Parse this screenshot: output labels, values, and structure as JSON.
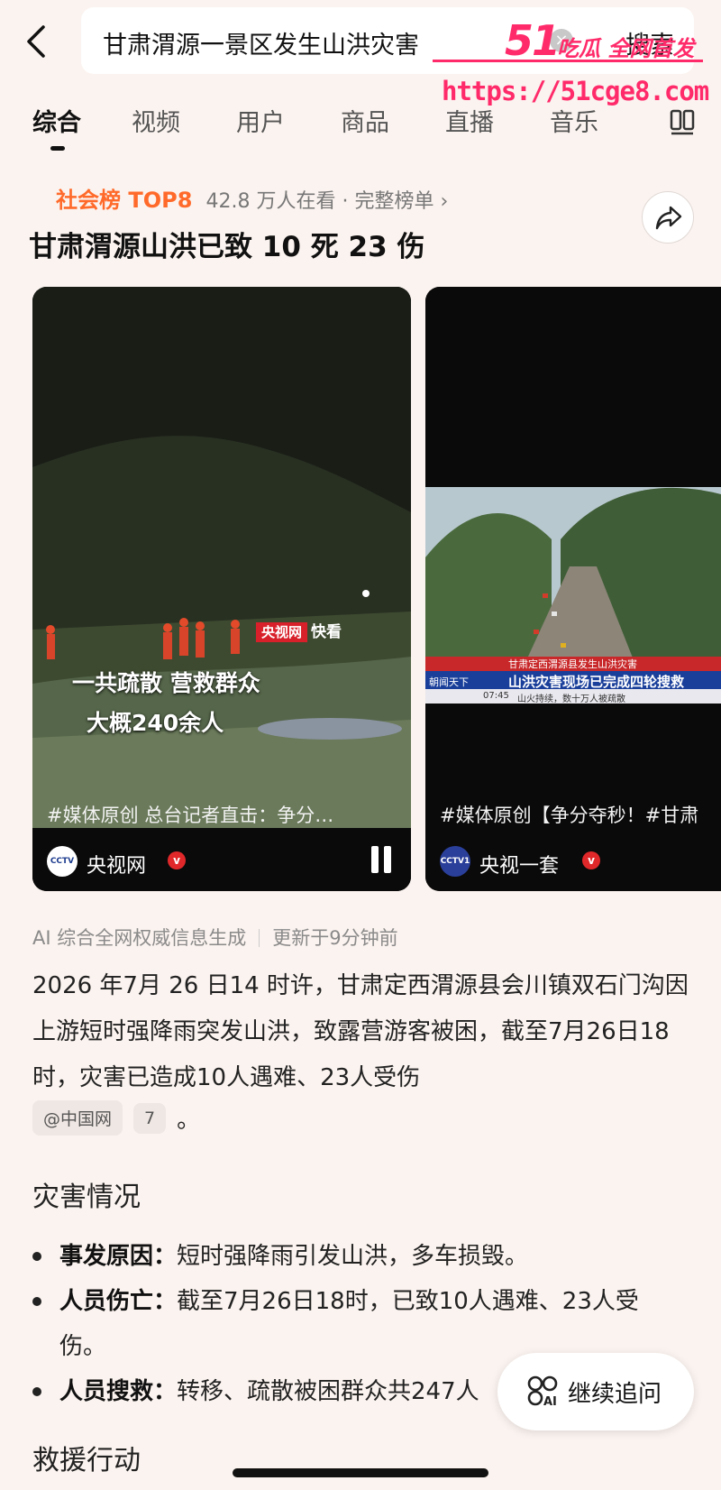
{
  "search": {
    "query": "甘肃渭源一景区发生山洪灾害",
    "button": "搜索"
  },
  "watermark": {
    "number": "51",
    "slogan": "吃瓜 全网首发",
    "url": "https://51cge8.com"
  },
  "tabs": [
    "综合",
    "视频",
    "用户",
    "商品",
    "直播",
    "音乐"
  ],
  "ranking": {
    "badge": "社会榜 TOP8",
    "meta": "42.8 万人在看 · 完整榜单 ›"
  },
  "headline": "甘肃渭源山洪已致 10 死 23 伤",
  "videos": [
    {
      "overlay_tag_1": "央视网",
      "overlay_tag_2": "快看",
      "overlay_line_1": "一共疏散 营救群众",
      "overlay_line_2": "大概240余人",
      "caption": "#媒体原创  总台记者直击：争分…",
      "author": "央视网",
      "avatar": "CCTV"
    },
    {
      "banner_top": "甘肃定西渭源县发生山洪灾害",
      "banner_main": "山洪灾害现场已完成四轮搜救",
      "banner_sub": "山火持续，数十万人被疏散",
      "program": "朝闻天下",
      "time": "07:45",
      "caption": "#媒体原创【争分夺秒！#甘肃",
      "author": "央视一套",
      "avatar": "CCTV1"
    }
  ],
  "ai_meta": {
    "source": "AI 综合全网权威信息生成",
    "updated": "更新于9分钟前"
  },
  "summary": "2026 年7月 26 日14 时许，甘肃定西渭源县会川镇双石门沟因上游短时强降雨突发山洪，致露营游客被困，截至7月26日18时，灾害已造成10人遇难、23人受伤",
  "citation": {
    "source": "@中国网",
    "count": "7",
    "end": "。"
  },
  "section_disaster": {
    "title": "灾害情况",
    "items": [
      {
        "label": "事发原因：",
        "text": "短时强降雨引发山洪，多车损毁。"
      },
      {
        "label": "人员伤亡：",
        "text": "截至7月26日18时，已致10人遇难、23人受伤。"
      },
      {
        "label": "人员搜救：",
        "text": "转移、疏散被困群众共247人"
      }
    ]
  },
  "section_rescue": {
    "title": "救援行动"
  },
  "followup_button": "继续追问"
}
